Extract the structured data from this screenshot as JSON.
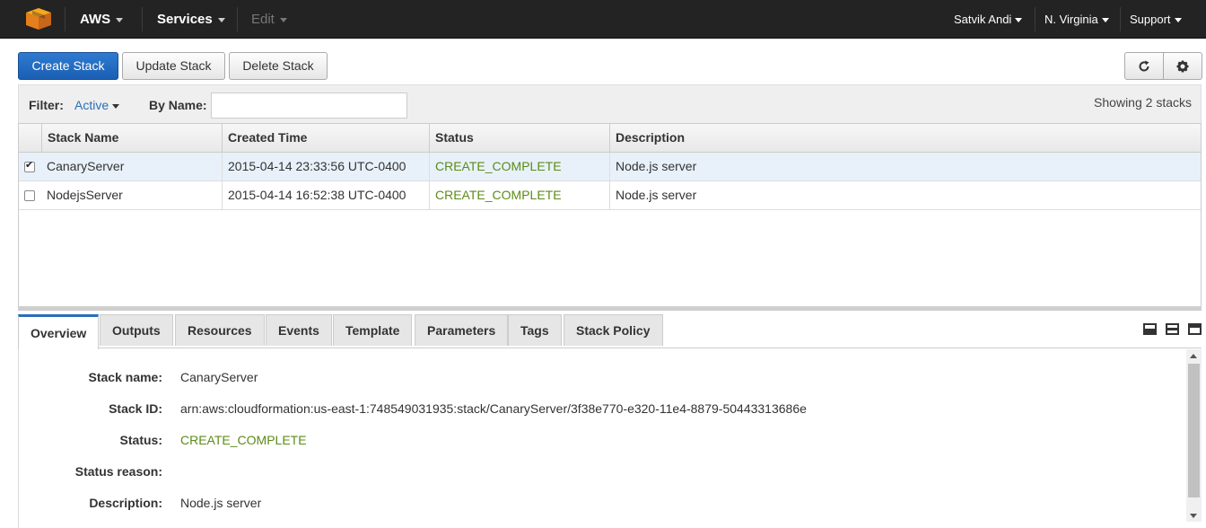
{
  "nav": {
    "brand": "AWS",
    "services": "Services",
    "edit": "Edit",
    "user": "Satvik Andi",
    "region": "N. Virginia",
    "support": "Support"
  },
  "toolbar": {
    "create": "Create Stack",
    "update": "Update Stack",
    "delete": "Delete Stack",
    "refresh_icon": "refresh-icon",
    "settings_icon": "gear-icon"
  },
  "filter": {
    "label": "Filter:",
    "value": "Active",
    "by_name_label": "By Name:",
    "by_name_value": "",
    "showing": "Showing 2 stacks"
  },
  "table": {
    "headers": [
      "Stack Name",
      "Created Time",
      "Status",
      "Description"
    ],
    "rows": [
      {
        "checked": true,
        "name": "CanaryServer",
        "created": "2015-04-14 23:33:56 UTC-0400",
        "status": "CREATE_COMPLETE",
        "description": "Node.js server"
      },
      {
        "checked": false,
        "name": "NodejsServer",
        "created": "2015-04-14 16:52:38 UTC-0400",
        "status": "CREATE_COMPLETE",
        "description": "Node.js server"
      }
    ]
  },
  "tabs": [
    "Overview",
    "Outputs",
    "Resources",
    "Events",
    "Template",
    "Parameters",
    "Tags",
    "Stack Policy"
  ],
  "overview": {
    "stack_name_label": "Stack name:",
    "stack_name": "CanaryServer",
    "stack_id_label": "Stack ID:",
    "stack_id": "arn:aws:cloudformation:us-east-1:748549031935:stack/CanaryServer/3f38e770-e320-11e4-8879-50443313686e",
    "status_label": "Status:",
    "status": "CREATE_COMPLETE",
    "status_reason_label": "Status reason:",
    "status_reason": "",
    "description_label": "Description:",
    "description": "Node.js server"
  },
  "colors": {
    "navbar": "#232323",
    "primary_button": "#1a5fb4",
    "status_green": "#5b8c17",
    "link_blue": "#2a6ebb",
    "selected_row": "#e8f1fa"
  }
}
